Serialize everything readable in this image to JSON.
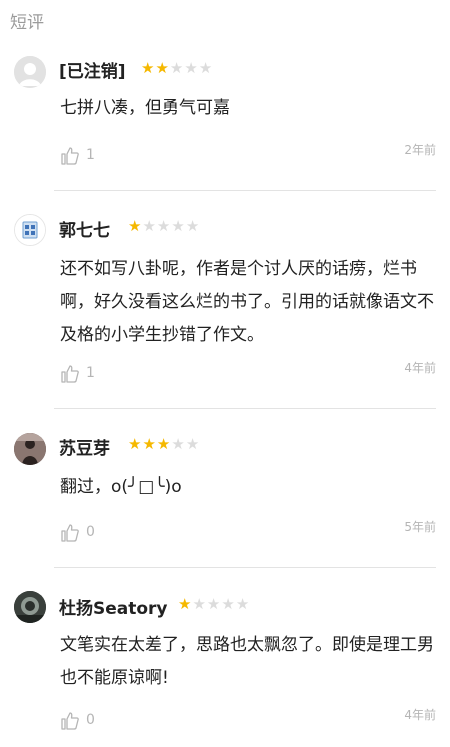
{
  "section": {
    "title": "短评"
  },
  "reviews": [
    {
      "username": "[已注销]",
      "rating": 2,
      "content": "七拼八凑，但勇气可嘉",
      "likes": "1",
      "time": "2年前"
    },
    {
      "username": "郭七七",
      "rating": 1,
      "content": "还不如写八卦呢，作者是个讨人厌的话痨，烂书啊，好久没看这么烂的书了。引用的话就像语文不及格的小学生抄错了作文。",
      "likes": "1",
      "time": "4年前"
    },
    {
      "username": "苏豆芽",
      "rating": 3,
      "content": "翻过，o(╯□╰)o",
      "likes": "0",
      "time": "5年前"
    },
    {
      "username": "杜扬Seatory",
      "rating": 1,
      "content": "文笔实在太差了，思路也太飘忽了。即使是理工男也不能原谅啊!",
      "likes": "0",
      "time": "4年前"
    }
  ],
  "colors": {
    "star_on": "#f5b800",
    "star_off": "#dcdcdc",
    "meta_text": "#b5b5b5"
  },
  "icons": {
    "like": "thumbs-up-icon",
    "star": "star-icon"
  }
}
